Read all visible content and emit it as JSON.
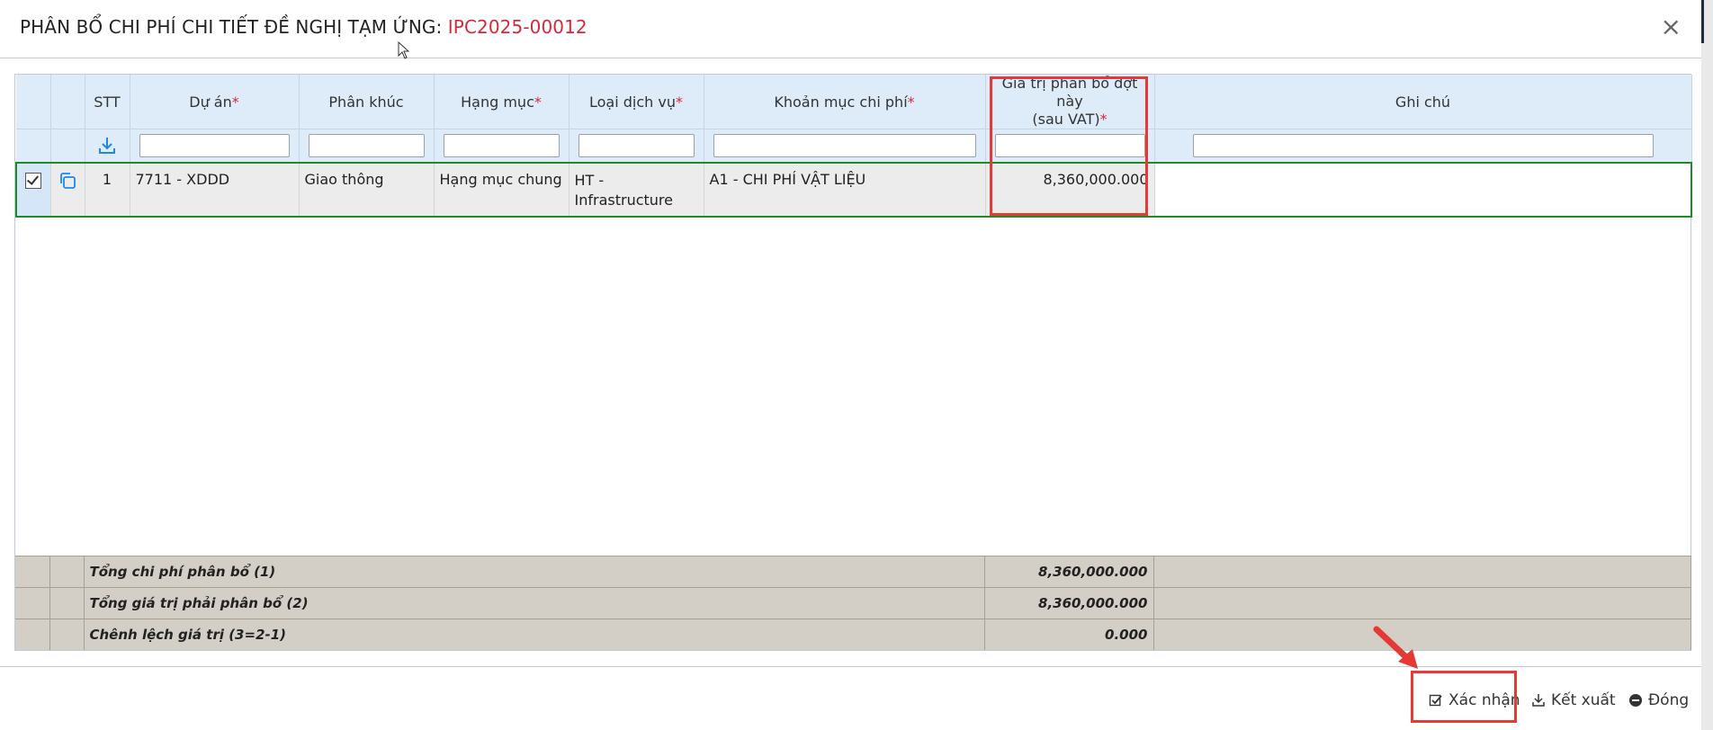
{
  "dialog": {
    "title_prefix": "PHÂN BỔ CHI PHÍ CHI TIẾT ĐỀ NGHỊ TẠM ỨNG: ",
    "title_code": "IPC2025-00012",
    "close_symbol": "×"
  },
  "columns": {
    "stt": "STT",
    "du_an": "Dự án",
    "phan_khuc": "Phân khúc",
    "hang_muc": "Hạng mục",
    "loai_dich_vu": "Loại dịch vụ",
    "khoan_muc": "Khoản mục chi phí",
    "gia_tri_line1": "Giá trị phân bổ đợt này",
    "gia_tri_line2": "(sau VAT)",
    "ghi_chu": "Ghi chú",
    "required_mark": "*"
  },
  "rows": [
    {
      "stt": "1",
      "du_an": "7711 - XDDD",
      "phan_khuc": "Giao thông",
      "hang_muc": "Hạng mục chung",
      "loai_dich_vu_1": "HT -",
      "loai_dich_vu_2": "Infrastructure",
      "khoan_muc": "A1 - CHI PHÍ VẬT LIỆU",
      "gia_tri": "8,360,000.000",
      "ghi_chu": "",
      "selected": true
    }
  ],
  "summary": [
    {
      "label": "Tổng chi phí phân bổ (1)",
      "value": "8,360,000.000"
    },
    {
      "label": "Tổng giá trị phải phân bổ (2)",
      "value": "8,360,000.000"
    },
    {
      "label": "Chênh lệch giá trị (3=2-1)",
      "value": "0.000"
    }
  ],
  "actions": {
    "confirm": "Xác nhận",
    "export": "Kết xuất",
    "close": "Đóng"
  },
  "colors": {
    "header_bg": "#deecfa",
    "accent_red": "#d6283b",
    "selected_row_border": "#1f8a2a",
    "summary_bg": "#d4cfc6",
    "highlight_box": "#e53935"
  }
}
